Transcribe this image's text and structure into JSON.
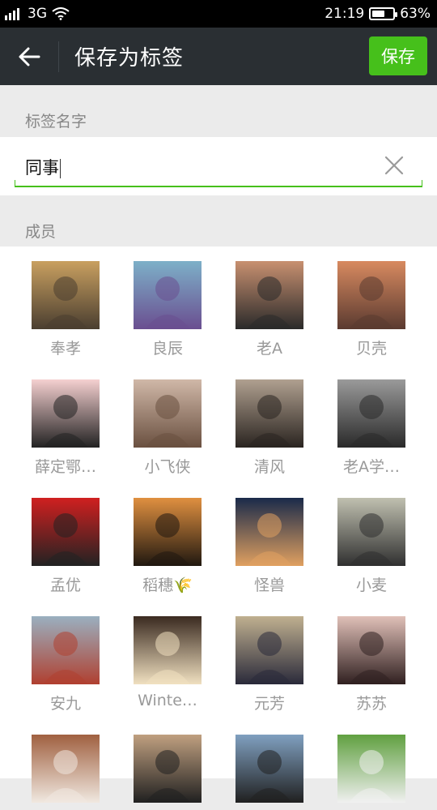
{
  "status_bar": {
    "network": "3G",
    "time": "21:19",
    "battery": "63%",
    "battery_level": 0.63
  },
  "app_bar": {
    "back_icon": "arrow-left-icon",
    "title": "保存为标签",
    "save_label": "保存"
  },
  "tag_section": {
    "label": "标签名字",
    "value": "同事",
    "clear_icon": "close-icon"
  },
  "members_section": {
    "label": "成员",
    "members": [
      {
        "name": "奉孝",
        "avatar_colors": [
          "#c9a060",
          "#4a3e30"
        ]
      },
      {
        "name": "良辰",
        "avatar_colors": [
          "#7db0c8",
          "#6a4e90"
        ]
      },
      {
        "name": "老A",
        "avatar_colors": [
          "#c89070",
          "#2a2a2a"
        ]
      },
      {
        "name": "贝壳",
        "avatar_colors": [
          "#d88a60",
          "#5a3a30"
        ]
      },
      {
        "name": "薛定鄂…",
        "avatar_colors": [
          "#f5d0d0",
          "#222222"
        ]
      },
      {
        "name": "小飞侠",
        "avatar_colors": [
          "#d0b8a8",
          "#6a5040"
        ]
      },
      {
        "name": "清风",
        "avatar_colors": [
          "#b0a090",
          "#2a2420"
        ]
      },
      {
        "name": "老A学…",
        "avatar_colors": [
          "#9a9a9a",
          "#2a2a2a"
        ]
      },
      {
        "name": "孟优",
        "avatar_colors": [
          "#d02020",
          "#222222"
        ]
      },
      {
        "name": "稻穗🌾",
        "avatar_colors": [
          "#e09040",
          "#201810"
        ]
      },
      {
        "name": "怪兽",
        "avatar_colors": [
          "#1a2a4a",
          "#e0a060"
        ]
      },
      {
        "name": "小麦",
        "avatar_colors": [
          "#c0c0b0",
          "#303030"
        ]
      },
      {
        "name": "安九",
        "avatar_colors": [
          "#9ab0c0",
          "#b04030"
        ]
      },
      {
        "name": "Winte…",
        "avatar_colors": [
          "#3a2a20",
          "#f0e0c0"
        ]
      },
      {
        "name": "元芳",
        "avatar_colors": [
          "#c0b090",
          "#2a2a3a"
        ]
      },
      {
        "name": "苏苏",
        "avatar_colors": [
          "#e0c0b8",
          "#302020"
        ]
      },
      {
        "name": "",
        "avatar_colors": [
          "#a06040",
          "#f0e8e0"
        ]
      },
      {
        "name": "",
        "avatar_colors": [
          "#c0a080",
          "#202020"
        ]
      },
      {
        "name": "",
        "avatar_colors": [
          "#80a0c0",
          "#202020"
        ]
      },
      {
        "name": "",
        "avatar_colors": [
          "#60a040",
          "#f0f0f0"
        ]
      }
    ]
  }
}
